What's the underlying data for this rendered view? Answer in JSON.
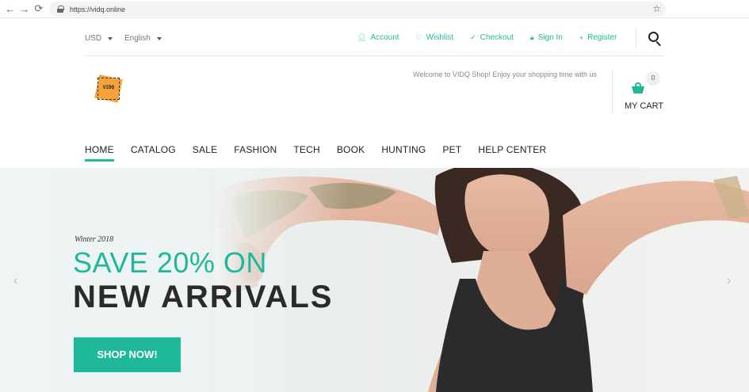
{
  "browser": {
    "url": "https://vidq.online"
  },
  "topbar": {
    "currency": "USD",
    "language": "English",
    "links": [
      {
        "label": "Account",
        "icon": "user-icon"
      },
      {
        "label": "Wishlist",
        "icon": "heart-icon"
      },
      {
        "label": "Checkout",
        "icon": "check-icon"
      },
      {
        "label": "Sign In",
        "icon": "lock-icon"
      },
      {
        "label": "Register",
        "icon": "user-plus-icon"
      }
    ]
  },
  "header": {
    "logo_text": "VIDQ",
    "welcome": "Welcome to VIDQ Shop! Enjoy your shopping time with us",
    "cart_count": "0",
    "cart_label": "MY CART"
  },
  "nav": {
    "items": [
      "HOME",
      "CATALOG",
      "SALE",
      "FASHION",
      "TECH",
      "BOOK",
      "HUNTING",
      "PET",
      "HELP CENTER"
    ]
  },
  "hero": {
    "eyebrow": "Winter 2018",
    "line1": "SAVE 20% ON",
    "line2": "NEW ARRIVALS",
    "cta": "SHOP NOW!"
  },
  "colors": {
    "accent": "#20b89b",
    "logo": "#f5a23a"
  }
}
